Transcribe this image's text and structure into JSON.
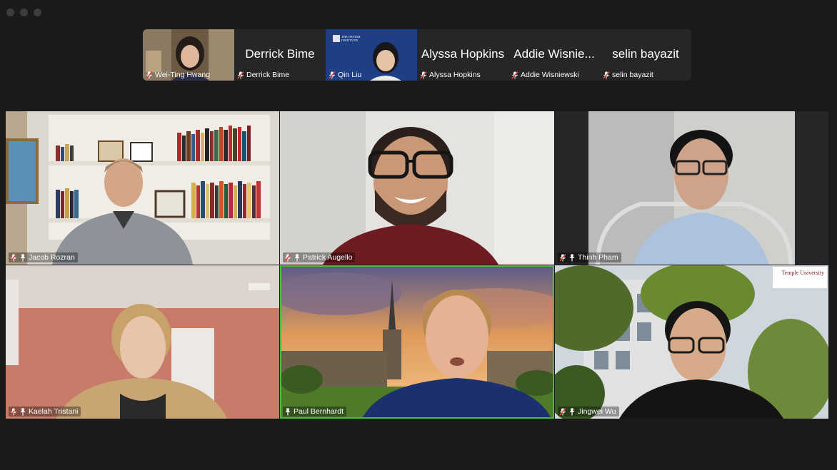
{
  "window": {
    "controls": [
      "close",
      "minimize",
      "zoom"
    ]
  },
  "strip": [
    {
      "name": "Wei-Ting Hwang",
      "label": "Wei-Ting Hwang",
      "mode": "video",
      "muted": true
    },
    {
      "name": "Derrick Bime",
      "label": "Derrick Bime",
      "mode": "name",
      "muted": true
    },
    {
      "name": "Qin Liu",
      "label": "Qin Liu",
      "mode": "video",
      "muted": true,
      "bg_text": "THE WISTAR INSTITUTE"
    },
    {
      "name": "Alyssa Hopkins",
      "label": "Alyssa Hopkins",
      "mode": "name",
      "muted": true
    },
    {
      "name": "Addie Wisnie...",
      "label": "Addie Wisniewski",
      "mode": "name",
      "muted": true
    },
    {
      "name": "selin bayazit",
      "label": "selin bayazit",
      "mode": "name",
      "muted": true
    }
  ],
  "grid": [
    {
      "name": "Jacob Rozran",
      "muted": true,
      "pinned": true
    },
    {
      "name": "Patrick Augello",
      "muted": true,
      "pinned": true
    },
    {
      "name": "Thinh Pham",
      "muted": true,
      "pinned": true
    },
    {
      "name": "Kaelah Tristani",
      "muted": true,
      "pinned": true
    },
    {
      "name": "Paul Bernhardt",
      "muted": false,
      "pinned": true,
      "active_speaker": true
    },
    {
      "name": "Jingwei Wu",
      "muted": true,
      "pinned": true,
      "bg_text": "Temple University"
    }
  ],
  "colors": {
    "active_speaker_border": "#4cbb3f",
    "muted_icon": "#e0463c",
    "background": "#1a1a1a"
  },
  "icons": {
    "muted": "mic-muted-icon",
    "pinned": "pin-icon"
  }
}
